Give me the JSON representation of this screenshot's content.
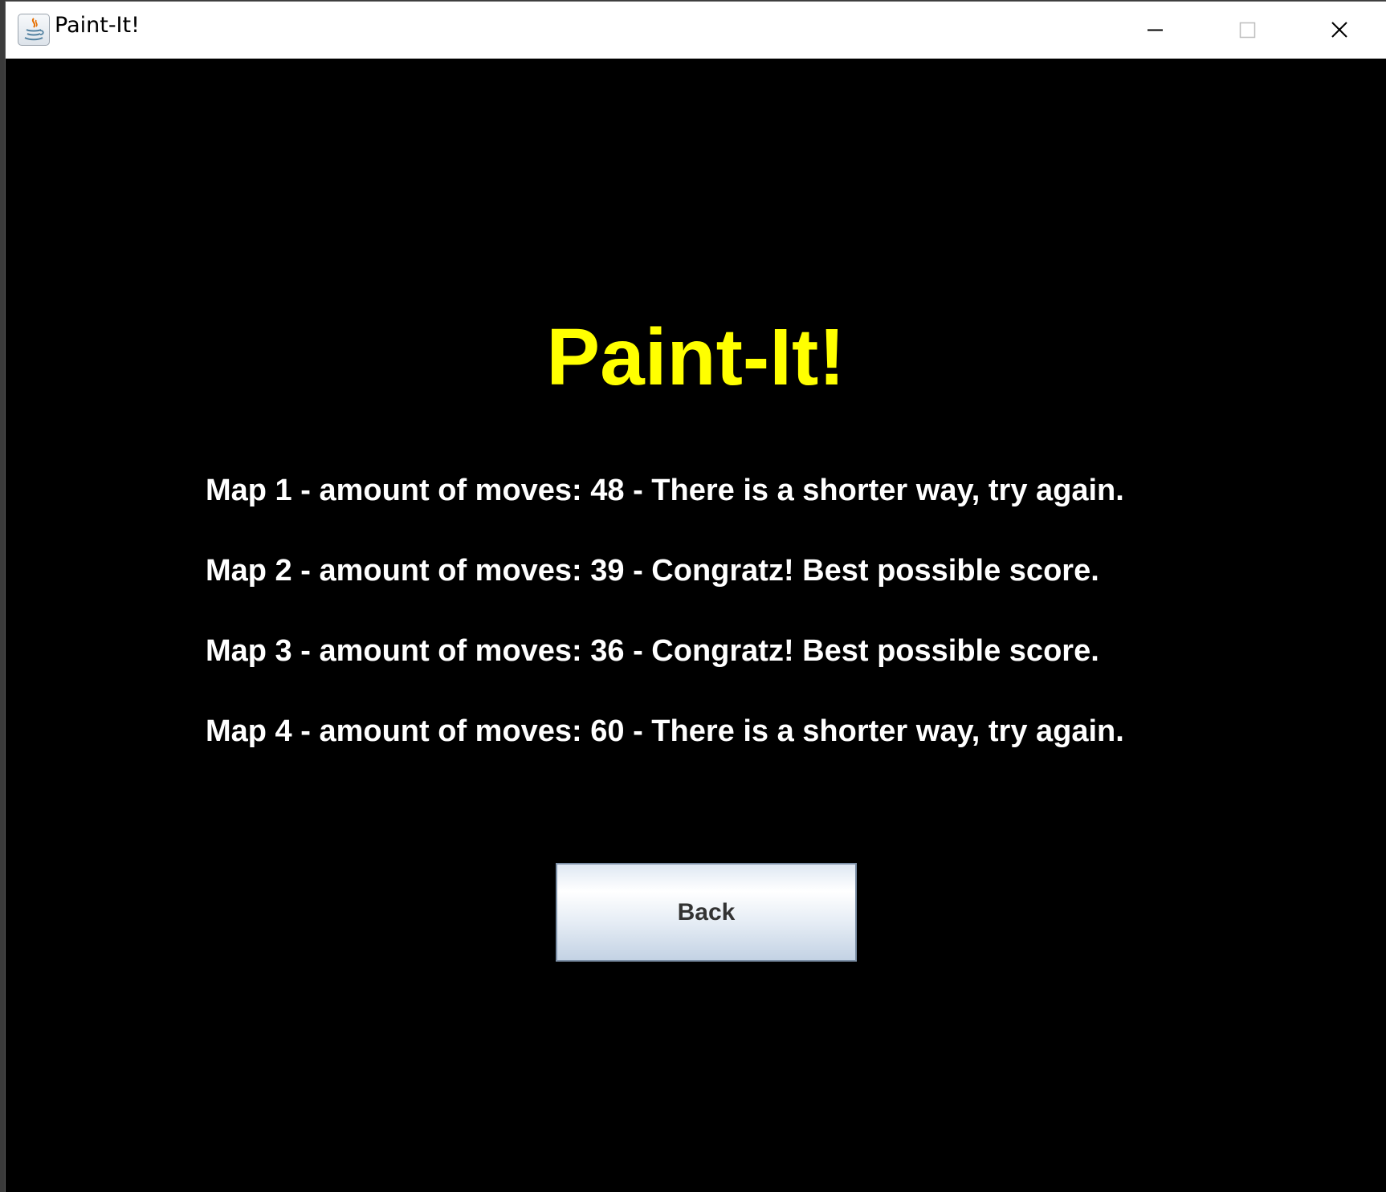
{
  "window": {
    "title": "Paint-It!",
    "icon": "java-app-icon",
    "controls": {
      "minimize": "minimize-icon",
      "maximize": "maximize-icon",
      "close": "close-icon"
    }
  },
  "screen": {
    "heading": "Paint-It!",
    "results": [
      "Map 1 - amount of moves: 48 - There is a shorter way, try again.",
      "Map 2 - amount of moves: 39 - Congratz! Best possible score.",
      "Map 3 - amount of moves: 36 - Congratz! Best possible score.",
      "Map 4 - amount of moves: 60 - There is a shorter way, try again."
    ],
    "back_label": "Back"
  },
  "colors": {
    "background": "#000000",
    "heading": "#ffff00",
    "text": "#ffffff"
  }
}
